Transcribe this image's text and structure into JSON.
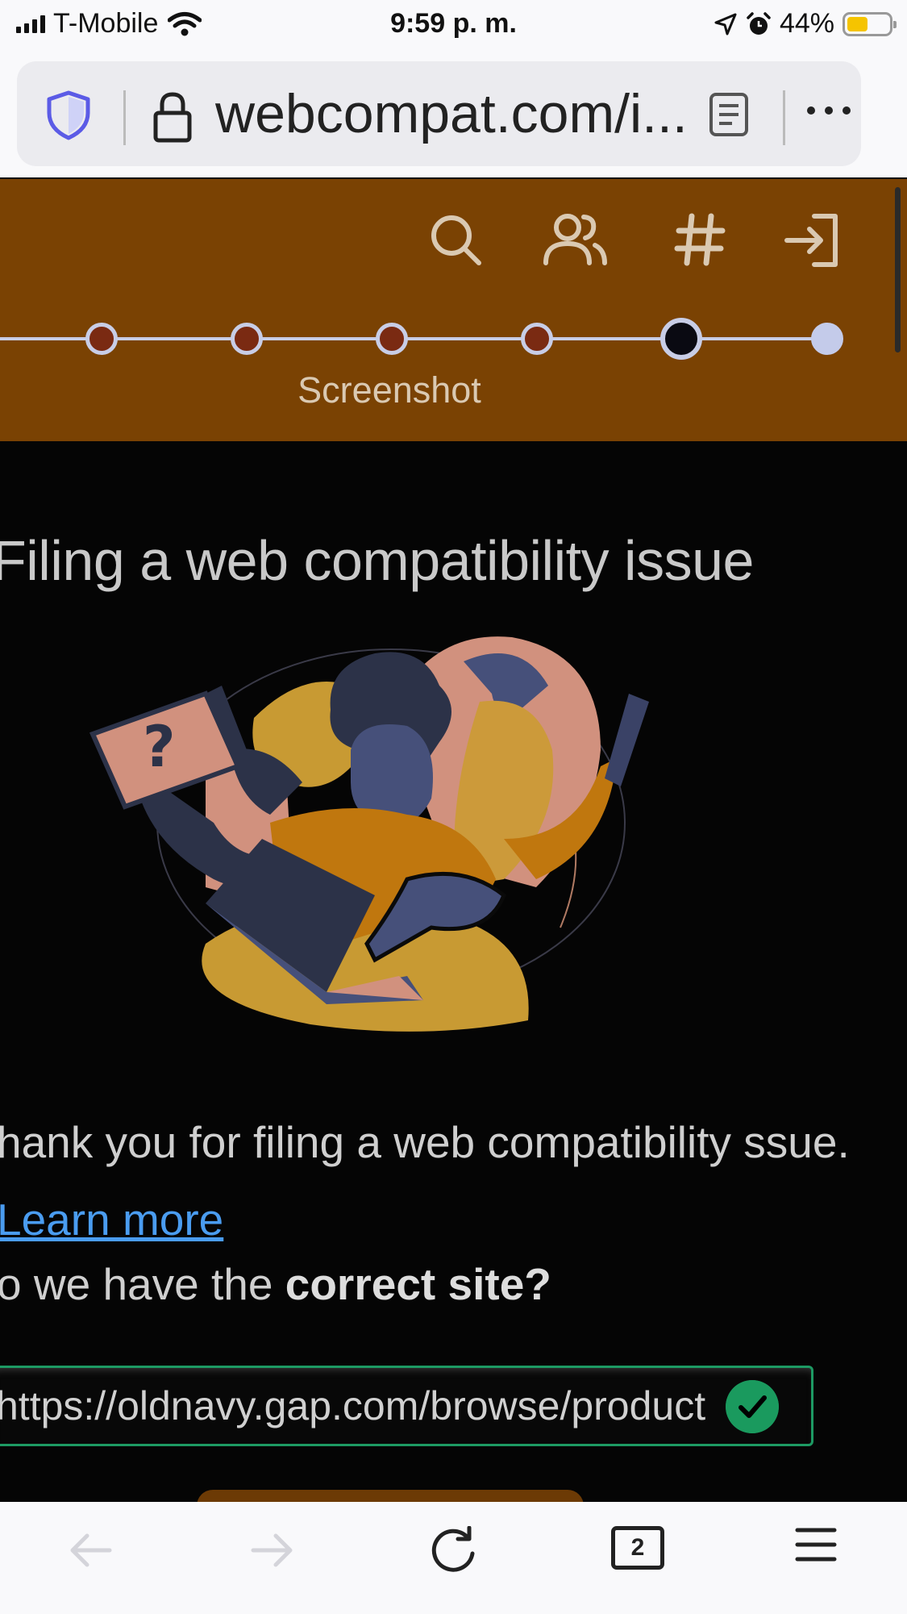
{
  "status_bar": {
    "carrier": "T-Mobile",
    "time": "9:59 p. m.",
    "battery_percent": "44%",
    "battery_level": 0.44,
    "icons": [
      "signal-icon",
      "wifi-icon",
      "location-icon",
      "alarm-icon",
      "battery-icon"
    ]
  },
  "browser": {
    "url_display": "webcompat.com/i...",
    "tab_count": "2",
    "icons": [
      "shield-icon",
      "lock-icon",
      "reader-mode-icon",
      "more-icon",
      "back-icon",
      "forward-icon",
      "reload-icon",
      "menu-icon"
    ]
  },
  "header": {
    "icons": [
      "search-icon",
      "users-icon",
      "hash-icon",
      "login-icon"
    ],
    "current_step_label": "Screenshot",
    "steps_total": 6,
    "current_step": 5
  },
  "content": {
    "heading": "Filing a web compatibility issue",
    "intro_prefix": "hank you for filing a web compatibility ssue.",
    "learn_more": "Learn more",
    "question_prefix": "o we have the ",
    "question_bold": "correct site?",
    "site_url": "https://oldnavy.gap.com/browse/product"
  },
  "colors": {
    "header_bg": "#7a4203",
    "page_bg": "#050505",
    "valid_green": "#1d9a63",
    "link_blue": "#4a9cf0"
  }
}
